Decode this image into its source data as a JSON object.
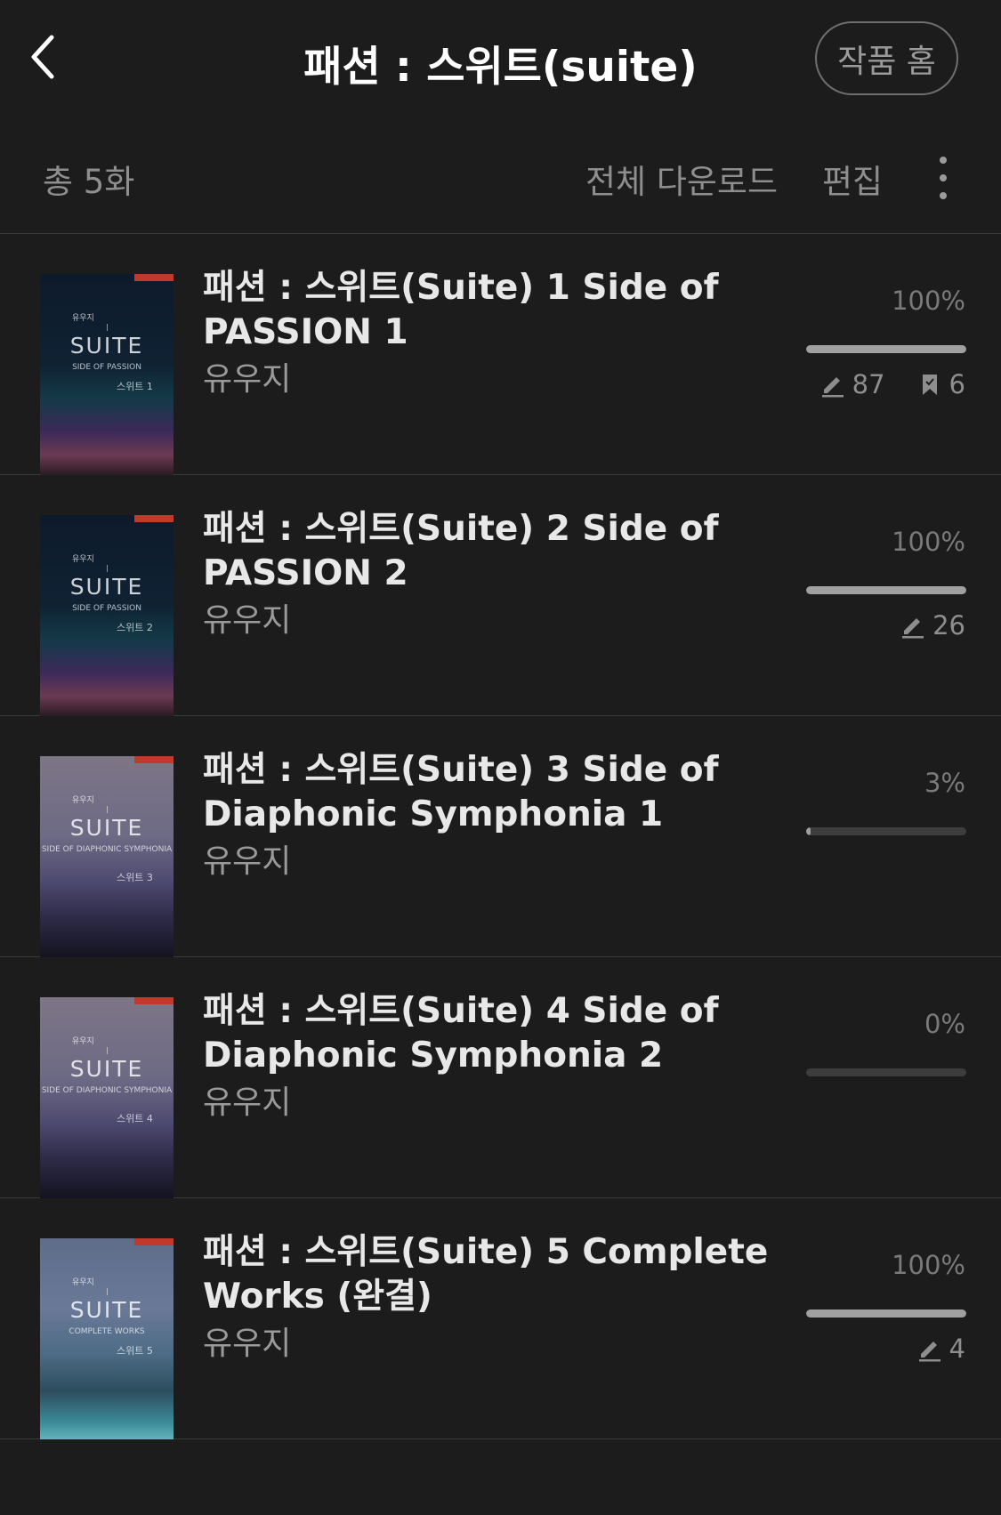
{
  "header": {
    "title": "패션 : 스위트(suite)",
    "home_label": "작품 홈"
  },
  "toolbar": {
    "count": "총 5화",
    "download_all": "전체 다운로드",
    "edit": "편집"
  },
  "episodes": [
    {
      "title": "패션 : 스위트(Suite) 1 Side of PASSION 1",
      "author": "유우지",
      "progress_label": "100%",
      "progress": 1.0,
      "notes": "87",
      "bookmarks": "6",
      "cover": {
        "author": "유우지",
        "suite": "SUITE",
        "subtitle": "SIDE OF PASSION",
        "volume": "스위트 1"
      }
    },
    {
      "title": "패션 : 스위트(Suite) 2 Side of PASSION 2",
      "author": "유우지",
      "progress_label": "100%",
      "progress": 1.0,
      "notes": "26",
      "cover": {
        "author": "유우지",
        "suite": "SUITE",
        "subtitle": "SIDE OF PASSION",
        "volume": "스위트 2"
      }
    },
    {
      "title": "패션 : 스위트(Suite) 3 Side of Diaphonic Symphonia 1",
      "author": "유우지",
      "progress_label": "3%",
      "progress": 0.03,
      "cover": {
        "author": "유우지",
        "suite": "SUITE",
        "subtitle": "SIDE OF DIAPHONIC SYMPHONIA",
        "volume": "스위트 3"
      }
    },
    {
      "title": "패션 : 스위트(Suite) 4 Side of Diaphonic Symphonia 2",
      "author": "유우지",
      "progress_label": "0%",
      "progress": 0.0,
      "cover": {
        "author": "유우지",
        "suite": "SUITE",
        "subtitle": "SIDE OF DIAPHONIC SYMPHONIA",
        "volume": "스위트 4"
      }
    },
    {
      "title": "패션 : 스위트(Suite) 5 Complete Works (완결)",
      "author": "유우지",
      "progress_label": "100%",
      "progress": 1.0,
      "notes": "4",
      "cover": {
        "author": "유우지",
        "suite": "SUITE",
        "subtitle": "COMPLETE WORKS",
        "volume": "스위트 5"
      }
    }
  ],
  "icons": {
    "back": "chevron-left-icon",
    "more": "more-vertical-icon",
    "note": "pencil-icon",
    "bookmark": "bookmark-icon"
  },
  "colors": {
    "background": "#1c1c1c",
    "progress_fill": "#a0a0a0",
    "progress_track": "#3d3d3d"
  }
}
